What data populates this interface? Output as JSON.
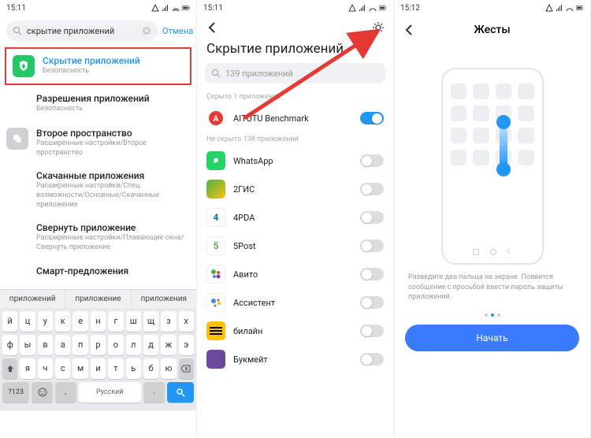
{
  "status": {
    "time1": "15:11",
    "time2": "15:11",
    "time3": "15:12"
  },
  "p1": {
    "search_value": "скрытие приложений",
    "cancel": "Отмена",
    "rows": [
      {
        "title": "Скрытие приложений",
        "sub": "Безопасность"
      },
      {
        "title": "Разрешения приложений",
        "sub": "Безопасность"
      },
      {
        "title": "Второе пространство",
        "sub": "Расширенные настройки/Второе пространство"
      },
      {
        "title": "Скачанные приложения",
        "sub": "Расширенные настройки/Спец. возможности/Основные/Скачанные приложения"
      },
      {
        "title": "Свернуть приложение",
        "sub": "Расширенные настройки/Плавающие окна/Свернуть приложение"
      },
      {
        "title": "Смарт-предложения",
        "sub": ""
      }
    ],
    "suggestions": [
      "приложений",
      "приложение",
      "приложения"
    ],
    "kb": {
      "r1": [
        "й",
        "ц",
        "у",
        "к",
        "е",
        "н",
        "г",
        "ш",
        "щ",
        "з",
        "х"
      ],
      "r2": [
        "ф",
        "ы",
        "в",
        "а",
        "п",
        "р",
        "о",
        "л",
        "д",
        "ж",
        "э"
      ],
      "r3": [
        "я",
        "ч",
        "с",
        "м",
        "и",
        "т",
        "ь",
        "б",
        "ю"
      ],
      "num": "?123",
      "space": "Русский"
    }
  },
  "p2": {
    "title": "Скрытие приложений",
    "search_ph": "139 приложений",
    "sect1": "Скрыто 1 приложение",
    "sect2": "Не скрыто 138 приложений",
    "apps_hidden": [
      {
        "name": "AITUTU Benchmark"
      }
    ],
    "apps": [
      {
        "name": "WhatsApp"
      },
      {
        "name": "2ГИС"
      },
      {
        "name": "4PDA"
      },
      {
        "name": "5Post"
      },
      {
        "name": "Авито"
      },
      {
        "name": "Ассистент"
      },
      {
        "name": "билайн"
      },
      {
        "name": "Букмейт"
      }
    ]
  },
  "p3": {
    "title": "Жесты",
    "hint": "Разведите два пальца на экране. Появится сообщение с просьбой ввести пароль защиты приложений.",
    "start": "Начать"
  }
}
